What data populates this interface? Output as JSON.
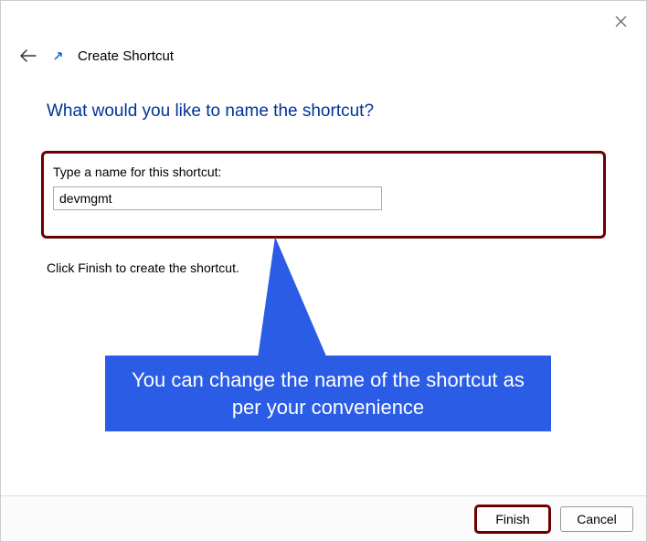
{
  "window": {
    "title": "Create Shortcut"
  },
  "heading": "What would you like to name the shortcut?",
  "field": {
    "label": "Type a name for this shortcut:",
    "value": "devmgmt"
  },
  "instruction": "Click Finish to create the shortcut.",
  "callout": "You can change the name of the shortcut as per your convenience",
  "buttons": {
    "finish": "Finish",
    "cancel": "Cancel"
  }
}
